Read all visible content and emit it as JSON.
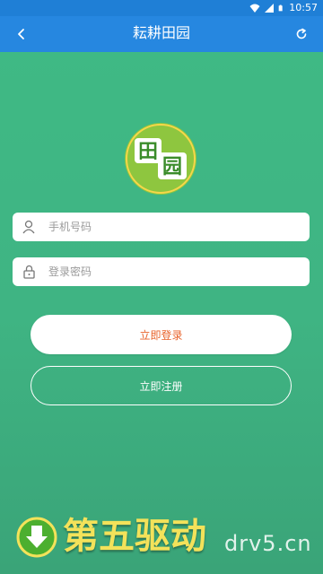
{
  "status_bar": {
    "time": "10:57",
    "wifi_icon": "wifi-icon",
    "signal_icon": "signal-icon",
    "battery_icon": "battery-icon"
  },
  "nav": {
    "title": "耘耕田园",
    "back_icon": "back-chevron-icon",
    "refresh_icon": "refresh-icon"
  },
  "logo": {
    "text_top": "田",
    "text_bottom": "园"
  },
  "form": {
    "phone_placeholder": "手机号码",
    "phone_value": "",
    "password_placeholder": "登录密码",
    "password_value": ""
  },
  "buttons": {
    "login_label": "立即登录",
    "register_label": "立即注册"
  },
  "watermark": {
    "cn": "第五驱动",
    "en": "drv5.cn"
  },
  "colors": {
    "nav": "#2687e0",
    "status": "#1f7fd6",
    "bg": "#3fb483",
    "login_text": "#e8622a"
  }
}
